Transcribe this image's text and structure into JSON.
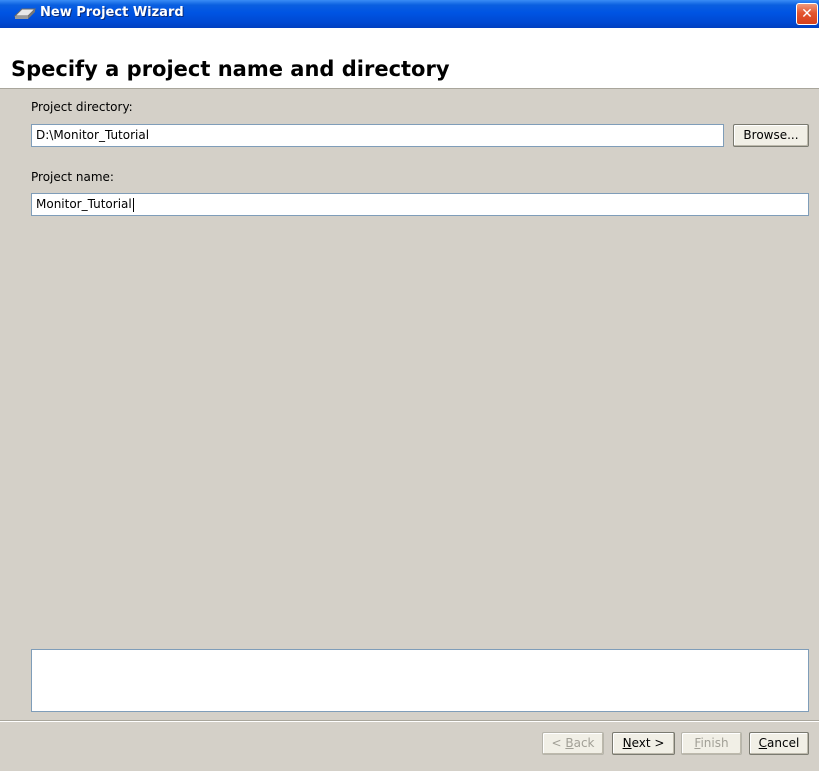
{
  "window": {
    "title": "New Project Wizard",
    "icon": "wizard-icon",
    "close_icon": "close-icon"
  },
  "header": {
    "title": "Specify a project name and directory"
  },
  "form": {
    "directory_label": "Project directory:",
    "directory_value": "D:\\Monitor_Tutorial",
    "browse_label": "Browse...",
    "name_label": "Project name:",
    "name_value": "Monitor_Tutorial"
  },
  "message_area": {
    "text": ""
  },
  "buttons": {
    "back": {
      "prefix": "< ",
      "mnemonic": "B",
      "rest": "ack",
      "enabled": false
    },
    "next": {
      "prefix": "",
      "mnemonic": "N",
      "rest": "ext >",
      "enabled": true
    },
    "finish": {
      "prefix": "",
      "mnemonic": "F",
      "rest": "inish",
      "enabled": false
    },
    "cancel": {
      "prefix": "",
      "mnemonic": "C",
      "rest": "ancel",
      "enabled": true
    }
  },
  "colors": {
    "titlebar": "#0054e3",
    "dialog_bg": "#d4d0c8",
    "field_border": "#7f9db9",
    "disabled_text": "#a19f96"
  }
}
